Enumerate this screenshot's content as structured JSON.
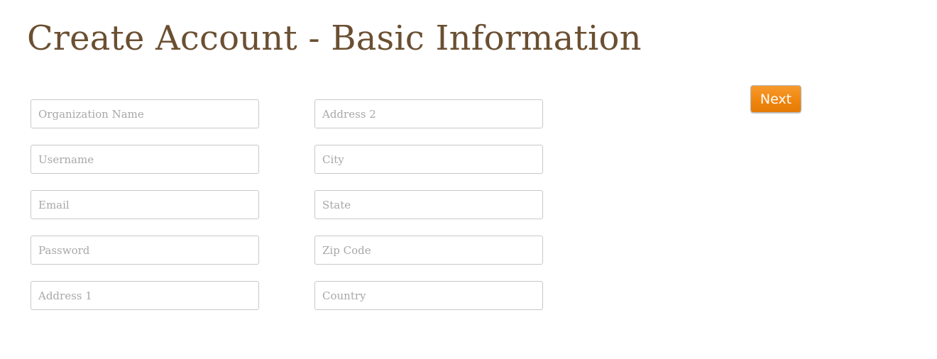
{
  "page": {
    "title": "Create Account - Basic Information"
  },
  "form": {
    "left_fields": [
      {
        "name": "organization-name",
        "placeholder": "Organization Name",
        "value": ""
      },
      {
        "name": "username",
        "placeholder": "Username",
        "value": ""
      },
      {
        "name": "email",
        "placeholder": "Email",
        "value": ""
      },
      {
        "name": "password",
        "placeholder": "Password",
        "value": ""
      },
      {
        "name": "address-1",
        "placeholder": "Address 1",
        "value": ""
      }
    ],
    "right_fields": [
      {
        "name": "address-2",
        "placeholder": "Address 2",
        "value": ""
      },
      {
        "name": "city",
        "placeholder": "City",
        "value": ""
      },
      {
        "name": "state",
        "placeholder": "State",
        "value": ""
      },
      {
        "name": "zip-code",
        "placeholder": "Zip Code",
        "value": ""
      },
      {
        "name": "country",
        "placeholder": "Country",
        "value": ""
      }
    ]
  },
  "actions": {
    "next_label": "Next"
  },
  "colors": {
    "title": "#6b4f32",
    "accent": "#f0860f",
    "field_border": "#c8c8c8",
    "placeholder": "#a8a8a8"
  }
}
